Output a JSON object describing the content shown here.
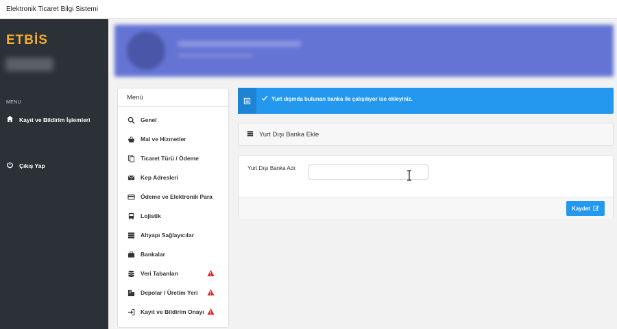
{
  "window": {
    "title": "Elektronik Ticaret Bilgi Sistemi"
  },
  "sidebar": {
    "logo": "ETBİS",
    "menu_caption": "MENU",
    "links": [
      {
        "label": "Kayıt ve Bildirim İşlemleri",
        "icon": "home-icon"
      },
      {
        "label": "Çıkış Yap",
        "icon": "power-icon"
      }
    ]
  },
  "menu": {
    "title": "Menü",
    "items": [
      {
        "label": "Genel",
        "icon": "search-icon",
        "warning": false
      },
      {
        "label": "Mal ve Hizmetler",
        "icon": "basket-icon",
        "warning": false
      },
      {
        "label": "Ticaret Türü / Ödeme",
        "icon": "copy-icon",
        "warning": false
      },
      {
        "label": "Kep Adresleri",
        "icon": "envelope-icon",
        "warning": false
      },
      {
        "label": "Ödeme ve Elektronik Para",
        "icon": "credit-card-icon",
        "warning": false
      },
      {
        "label": "Lojistik",
        "icon": "bus-icon",
        "warning": false
      },
      {
        "label": "Altyapı Sağlayıcılar",
        "icon": "server-icon",
        "warning": false
      },
      {
        "label": "Bankalar",
        "icon": "briefcase-icon",
        "warning": false
      },
      {
        "label": "Veri Tabanları",
        "icon": "database-icon",
        "warning": true
      },
      {
        "label": "Depolar / Üretim Yeri",
        "icon": "building-icon",
        "warning": true
      },
      {
        "label": "Kayıt ve Bildirim Onayı",
        "icon": "sign-in-icon",
        "warning": true
      }
    ]
  },
  "alert": {
    "text": "Yurt dışında bulunan banka ile çalışılıyor ise ekleyiniz.",
    "color": "#2497ee"
  },
  "form": {
    "header": "Yurt Dışı Banka Ekle",
    "bank_name_label": "Yurt Dışı Banka Adı:",
    "bank_name_value": "",
    "bank_name_placeholder": "",
    "save_label": "Kaydet"
  },
  "colors": {
    "accent": "#2497ee",
    "sidebar": "#2b3136",
    "logo": "#f4ae2a",
    "warning": "#e02424"
  }
}
